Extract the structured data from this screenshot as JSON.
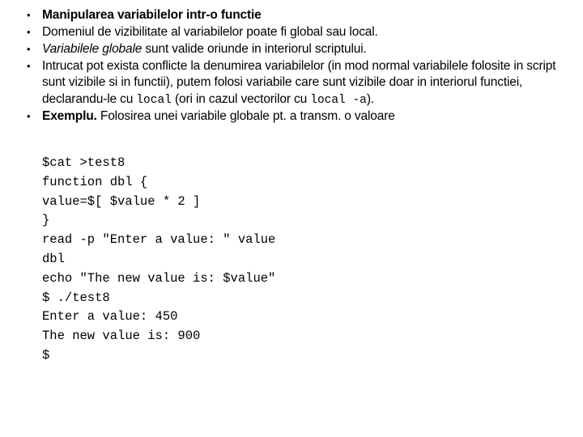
{
  "slide": {
    "background_color": "#ffffff",
    "text_color": "#000000",
    "bullet_glyph": "bullet-point"
  },
  "bullets": [
    {
      "id": "bullet-1",
      "style": "bold",
      "text": "Manipularea variabilelor intr-o functie"
    },
    {
      "id": "bullet-2",
      "style": "regular",
      "text": "Domeniul de vizibilitate al variabilelor poate fi global sau local."
    },
    {
      "id": "bullet-3",
      "style": "mixed-italic",
      "italic_lead": "Variabilele globale",
      "text_rest": "  sunt valide oriunde in interiorul scriptului."
    },
    {
      "id": "bullet-4",
      "style": "mixed-code",
      "part_1": "Intrucat pot exista conflicte la denumirea variabilelor (in mod normal variabilele folosite in script sunt vizibile si in functii), putem folosi variabile care sunt vizibile doar in interiorul functiei, declarandu-le cu ",
      "code_1": "local",
      "part_2": " (ori in cazul vectorilor cu ",
      "code_2": "local -a",
      "part_3": ")."
    },
    {
      "id": "bullet-5",
      "style": "mixed-bold",
      "bold_lead": "Exemplu.",
      "text_rest": " Folosirea unei variabile globale pt. a transm. o valoare"
    }
  ],
  "code_block": {
    "lines": [
      "$cat >test8",
      "function dbl {",
      "value=$[ $value * 2 ]",
      "}",
      "read -p \"Enter a value: \" value",
      "dbl",
      "echo \"The new value is: $value\"",
      "$ ./test8",
      "Enter a value: 450",
      "The new value is: 900",
      "$"
    ]
  }
}
